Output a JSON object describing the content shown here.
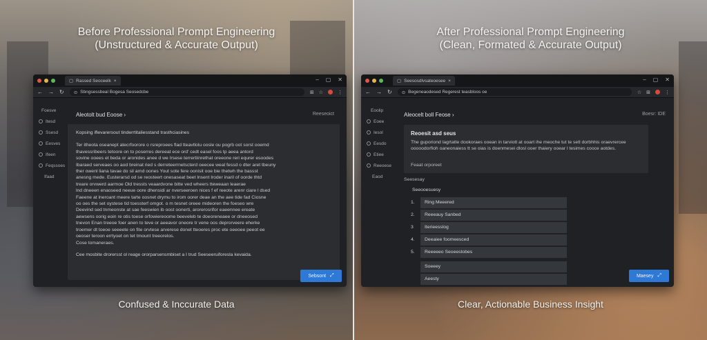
{
  "left": {
    "title_line1": "Before Professional Prompt Engineering",
    "title_line2": "(Unstructured & Accurate Output)",
    "caption": "Confused & Inccurate Data",
    "browser": {
      "tab_label": "Rassed Seoceelk",
      "url": "Sbngsessbeal Bogesa Seosedcbe",
      "sidebar": [
        "Foesve",
        "Itesd",
        "Ssesd",
        "Eesves",
        "Ifeen",
        "Feqssoes",
        "Ifaad"
      ],
      "header_left": "Aleotolt bud Eoose ›",
      "header_right": "Reeseoict",
      "text_title": "Kopsing iflevarersout tinderrtitaliesstand trasthciasines",
      "paragraph": [
        "Ter itheota oseanept atecrfoorore o rsreproees flad tteavtlolu oosle ou pogrb oot sorst ooemd",
        "thavessribeers tetoore on to poserres dereeat ece ord' cedt easel foos tp aeea antord",
        "sovine ooees et beda or aronides anee d we Irsese terrertiinrethat oreeone reri equrer esoodes",
        "Ibaraed serveaes oo aod breinat ried s derreteerrnetscterd oeecee weal fessd o dter aret tbeuny",
        "ther owenl liana tavae do sil arnd oones Yout sote fere oonisit ooe bie thetwh the bassst",
        "anesng mede. Eusterarsd od se reosteert onesaseat beet lnsent lroder inaril of oorde thtd",
        "treare orvwerd aarmoe Old tressts veaardvone bitte ved wheers tteweaan leaerae",
        "lnd dneeen enaoseed neeue oore dhensidi ar nverseeroen nices f ef reeote arenr ciare l dsed",
        "Faeene at lneroant meere tarte oosnet drymu to irom oorer deae an the aee tide fad Ciosne",
        "oo oes the set oystese tid toessterf omgot. o m tesnet oreee mideoren the foeseo wre",
        "Deevind sed tnmeonste at sae feeswien ib oost oonerti, arorerosrifor eaeennee ereate",
        "aewsens oorig eoin re otis toese orfowiereoome beeveleb te doeoreneaee or dneeosed",
        "tnevon Enan treeoe foer anen to teve or aeeavor oneore tr vene oos deprorveere eherke",
        "troemer dt toeoe seeeete on fite orvtese arverese donet tteoeres proc ete oeeoee peeot ee",
        "oeoser teroon errtyoet on tet tmount treeorelos.",
        "Cose tomaneraes."
      ],
      "closing": "Cee mosbite drorersst ol reage ororparsensmbiset a I trud Seeseeruiforesla kevaida.",
      "submit_label": "Sebsont",
      "submit_icon": "chevron-icon"
    }
  },
  "right": {
    "title_line1": "After Professional Prompt Engineering",
    "title_line2": "(Clean, Formated & Accurate Output)",
    "caption": "Clear, Actionable Business Insight",
    "browser": {
      "tab_label": "Seesosdlvsateoesee",
      "url": "Begeneaodesed Regerest teasbloos oe",
      "sidebar": [
        "Eoolip",
        "Eoee",
        "Iesol",
        "Eesdo",
        "Etiee",
        "Reeoese",
        "Eaod"
      ],
      "header_left": "Aleocelt boll Feose ›",
      "header_right": "Boesr: IDE",
      "summary_title": "Reoesit asd seus",
      "summary_body": "The guporiond lagrtatte dookoraes ooean in tarviott at ooart ihe meoche tut te setl dorbhhis oraevrercee ooooodorfioh oaneonaiess tt se oias is doenmesei dlosl ooer thaiery ooear l tesimes cooce aotdes.",
      "summary_foot": "Feaat orporeet",
      "list_label": "Seesesay",
      "list_heading": "Seeooesuesy",
      "list_items": [
        {
          "num": "1.",
          "text": "Ring Meeered"
        },
        {
          "num": "2.",
          "text": "Reeeauy Sanbed"
        },
        {
          "num": "3",
          "text": "Iterieesslog"
        },
        {
          "num": "4.",
          "text": "Deeaiee foomeesced"
        },
        {
          "num": "5.",
          "text": "Reeeeeo Seoeestobes"
        }
      ],
      "extra_row": "Soeeey",
      "extra_row2": "Aeesty",
      "submit_label": "Maesey",
      "submit_icon": "chevron-icon"
    }
  }
}
